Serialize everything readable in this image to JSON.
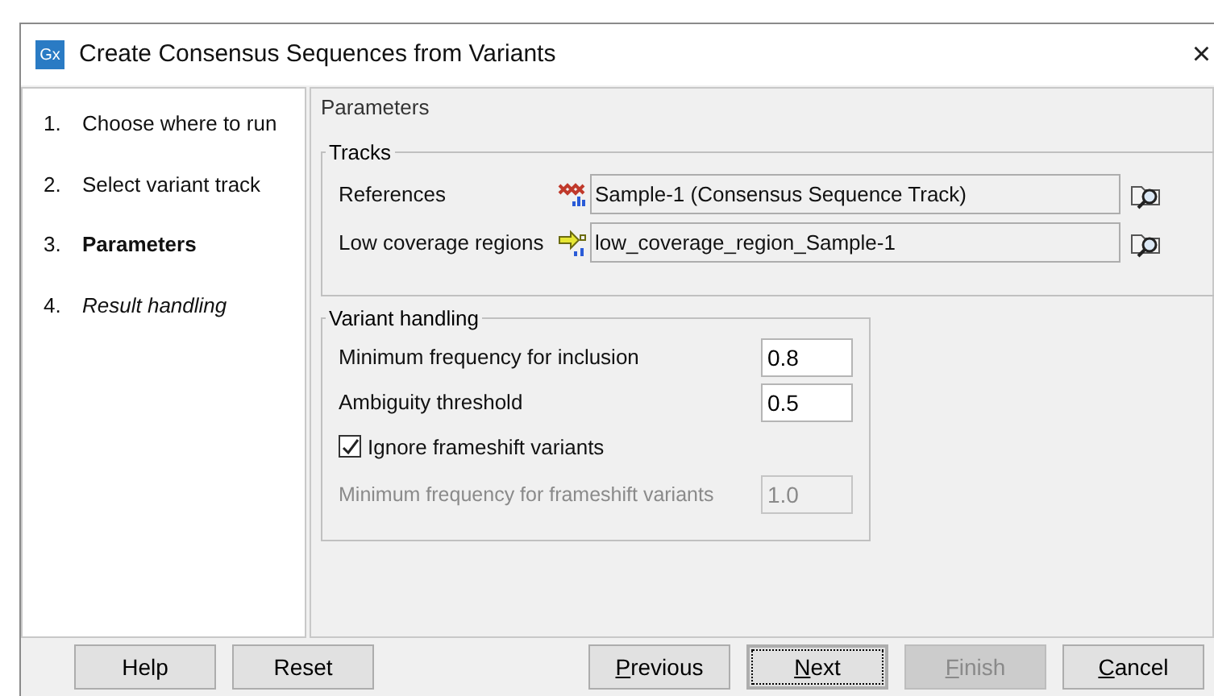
{
  "window": {
    "logo": "Gx",
    "title": "Create Consensus Sequences from Variants",
    "close": "×"
  },
  "steps": [
    {
      "number": "1.",
      "label": "Choose where to run",
      "selected": false,
      "kind": "done"
    },
    {
      "number": "2.",
      "label": "Select variant track",
      "selected": false,
      "kind": "done"
    },
    {
      "number": "3.",
      "label": "Parameters",
      "selected": true,
      "kind": "current"
    },
    {
      "number": "4.",
      "label": "Result handling",
      "selected": false,
      "kind": "upcoming"
    }
  ],
  "panel_title": "Parameters",
  "tracks": {
    "title": "Tracks",
    "rows": [
      {
        "label": "References",
        "kind": "consensus",
        "value": "Sample-1 (Consensus Sequence Track)"
      },
      {
        "label": "Low coverage regions",
        "kind": "annotation",
        "value": "low_coverage_region_Sample-1"
      }
    ]
  },
  "variant_handling": {
    "title": "Variant handling",
    "fields": [
      {
        "label": "Minimum frequency for inclusion",
        "value": "0.8",
        "disabled": false
      },
      {
        "label": "Ambiguity threshold",
        "value": "0.5",
        "disabled": false
      }
    ],
    "checkbox": {
      "label": "Ignore frameshift variants",
      "checked": true
    },
    "dependent_field": {
      "label": "Minimum frequency for frameshift variants",
      "value": "1.0",
      "disabled": true
    }
  },
  "buttons_left": [
    {
      "label": "Help",
      "mnemonic": false,
      "disabled": false,
      "focused": false
    },
    {
      "label": "Reset",
      "mnemonic": false,
      "disabled": false,
      "focused": false
    }
  ],
  "buttons_right": [
    {
      "label": "Previous",
      "mnemonic": true,
      "disabled": false,
      "focused": false
    },
    {
      "label": "Next",
      "mnemonic": true,
      "disabled": false,
      "focused": true
    },
    {
      "label": "Finish",
      "mnemonic": true,
      "disabled": true,
      "focused": false
    },
    {
      "label": "Cancel",
      "mnemonic": true,
      "disabled": false,
      "focused": false
    }
  ]
}
